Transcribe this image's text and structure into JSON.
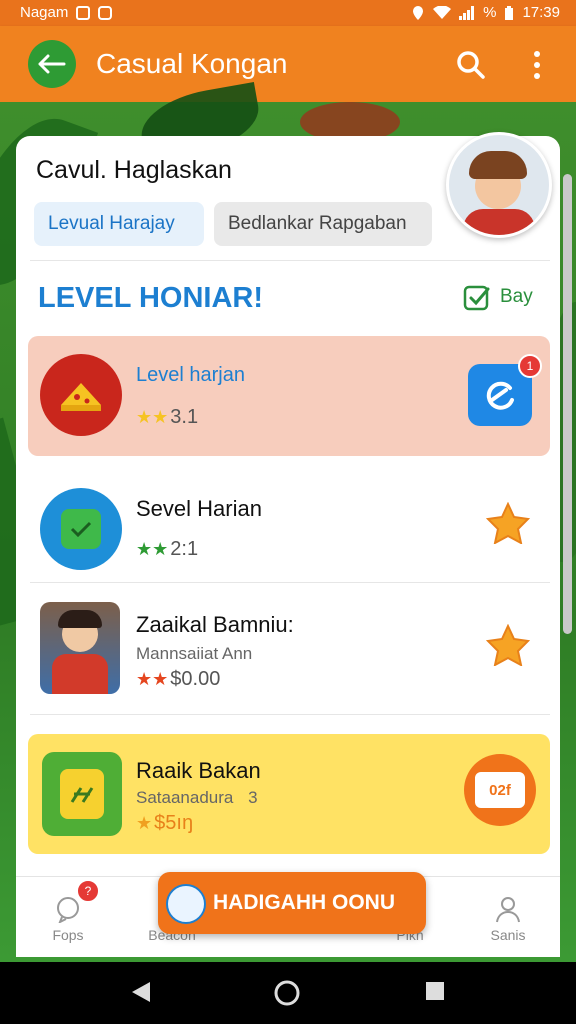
{
  "status_bar": {
    "carrier": "Nagam",
    "battery": "%",
    "time": "17:39"
  },
  "app_bar": {
    "title": "Casual Kongan",
    "icons": [
      "back-arrow-icon",
      "search-icon",
      "more-vert-icon"
    ]
  },
  "profile": {
    "name": "Cavul. Haglaskan",
    "chips": [
      "Levual Harajay",
      "Bedlankar Rapgaban"
    ]
  },
  "section": {
    "title": "LEVEL HONIAR!",
    "action_label": "Bay"
  },
  "rows": [
    {
      "title": "Level harjan",
      "rating": "3.1",
      "stars": 2,
      "badge": "1",
      "bg": "#f7cdbd"
    },
    {
      "title": "Sevel Harian",
      "rating": "2:1",
      "stars": 2
    },
    {
      "title": "Zaaikal Bamniu:",
      "subtitle": "Mannsaiiat Ann",
      "rating": "$0.00",
      "stars": 2
    },
    {
      "title": "Raaik Bakan",
      "subtitle": "Sataanadura",
      "subtitle_suffix": "3",
      "rating": "$5ıŋ",
      "stars": 1,
      "bg": "#ffe264",
      "end_label": "02f"
    }
  ],
  "bottom_nav": {
    "items": [
      "Fops",
      "Beacon",
      "Plkn",
      "Sanis"
    ],
    "fops_badge": "?",
    "cta_label": "HADIGAHH OONU"
  },
  "colors": {
    "primary": "#f0821f",
    "blue": "#1d7fd1",
    "green": "#2e9b34"
  }
}
